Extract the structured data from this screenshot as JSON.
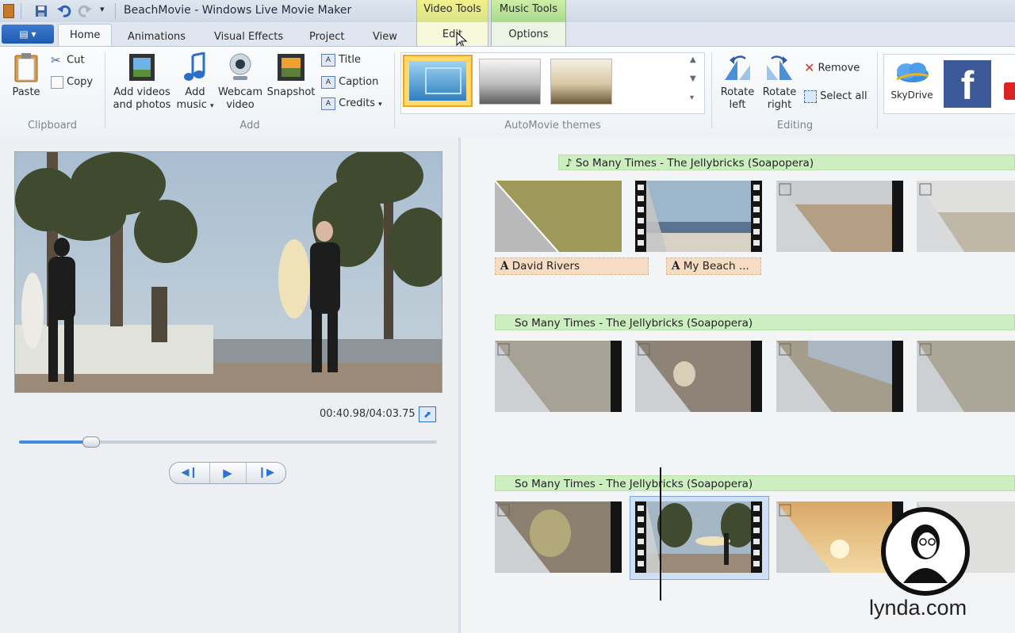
{
  "window": {
    "title": "BeachMovie - Windows Live Movie Maker"
  },
  "contextual_groups": {
    "video_tools": "Video Tools",
    "music_tools": "Music Tools"
  },
  "tabs": [
    "Home",
    "Animations",
    "Visual Effects",
    "Project",
    "View",
    "Edit",
    "Options"
  ],
  "ribbon": {
    "clipboard": {
      "label": "Clipboard",
      "paste": "Paste",
      "cut": "Cut",
      "copy": "Copy"
    },
    "add": {
      "label": "Add",
      "add_videos_1": "Add videos",
      "add_videos_2": "and photos",
      "add_music_1": "Add",
      "add_music_2": "music",
      "webcam_1": "Webcam",
      "webcam_2": "video",
      "snapshot": "Snapshot",
      "title": "Title",
      "caption": "Caption",
      "credits": "Credits"
    },
    "themes": {
      "label": "AutoMovie themes"
    },
    "editing": {
      "label": "Editing",
      "rotate_left_1": "Rotate",
      "rotate_left_2": "left",
      "rotate_right_1": "Rotate",
      "rotate_right_2": "right",
      "remove": "Remove",
      "select_all": "Select all"
    },
    "share": {
      "skydrive": "SkyDrive"
    }
  },
  "player": {
    "time": "00:40.98/04:03.75",
    "progress": 0.17
  },
  "storyboard": {
    "rows": [
      {
        "caption": "So Many Times - The Jellybricks (Soapopera)",
        "titles": [
          "David Rivers",
          "My Beach ..."
        ]
      },
      {
        "caption": "So Many Times - The Jellybricks (Soapopera)"
      },
      {
        "caption": "So Many Times - The Jellybricks (Soapopera)"
      }
    ]
  },
  "watermark": {
    "text": "lynda.com"
  },
  "colors": {
    "music_bar": "#cdeec1",
    "title_bar": "#f5dcc3",
    "accent": "#1d5bb0"
  }
}
